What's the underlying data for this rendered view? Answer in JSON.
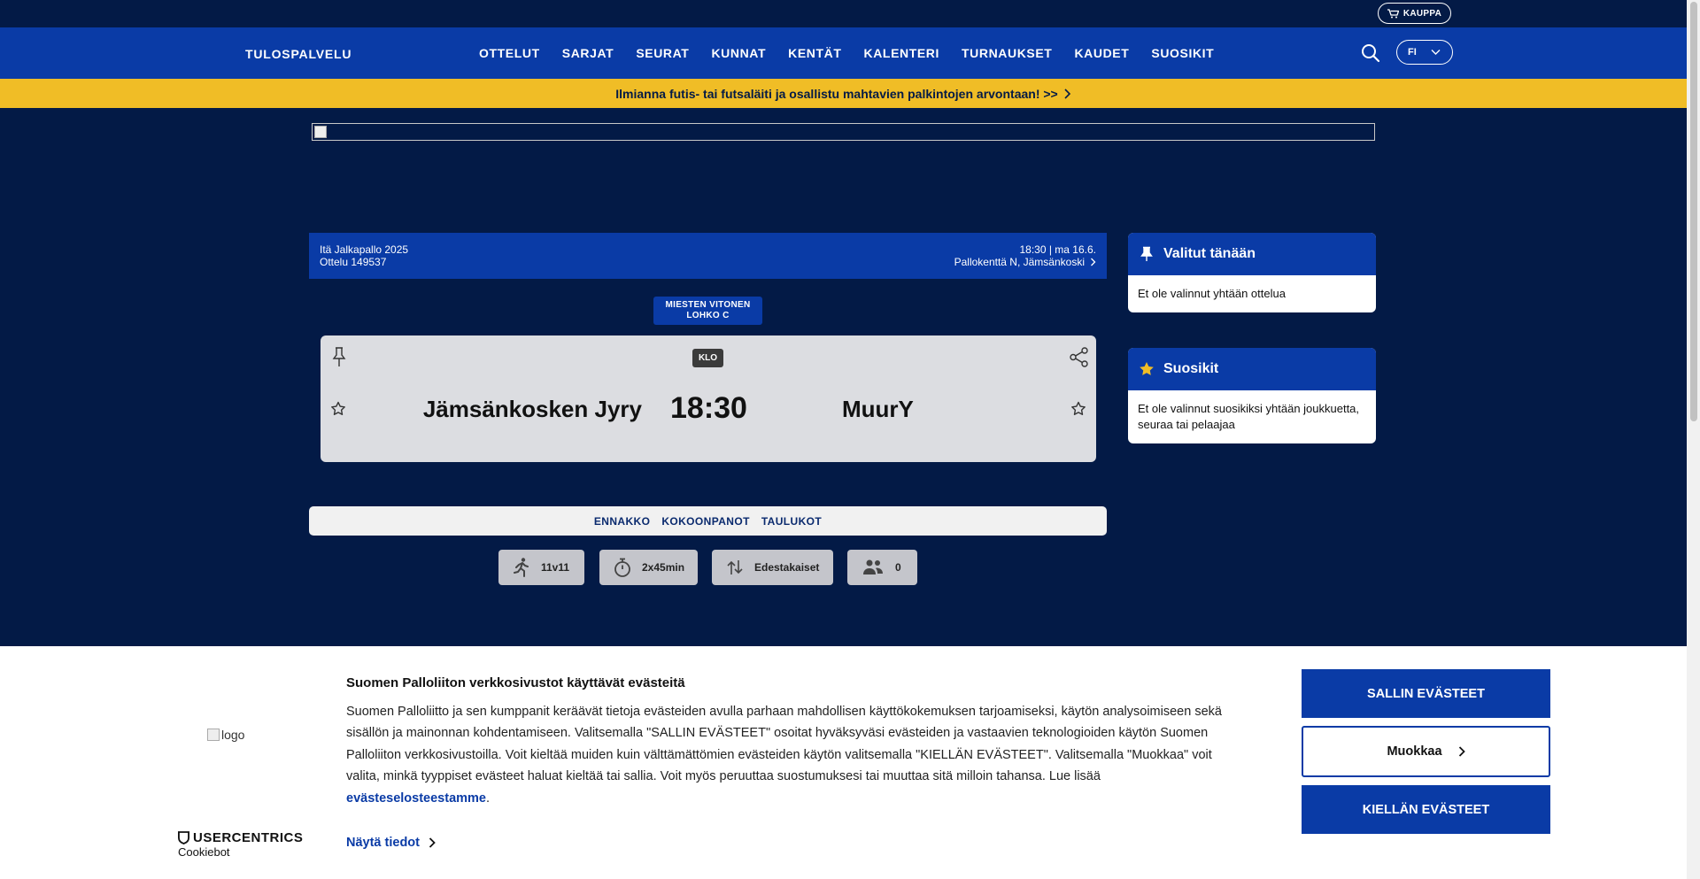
{
  "topbar": {
    "shop_label": "KAUPPA"
  },
  "nav": {
    "brand": "TULOSPALVELU",
    "items": [
      "OTTELUT",
      "SARJAT",
      "SEURAT",
      "KUNNAT",
      "KENTÄT",
      "KALENTERI",
      "TURNAUKSET",
      "KAUDET",
      "SUOSIKIT"
    ],
    "language": "FI"
  },
  "promo": {
    "text": "Ilmianna futis- tai futsaläiti ja osallistu mahtavien palkintojen arvontaan! >>"
  },
  "match": {
    "competition": "Itä Jalkapallo 2025",
    "match_id": "Ottelu 149537",
    "datetime": "18:30 | ma 16.6.",
    "venue": "Pallokenttä N, Jämsänkoski",
    "series_line1": "MIESTEN VITONEN",
    "series_line2": "LOHKO C",
    "status_badge": "KLO",
    "home_team": "Jämsänkosken Jyry",
    "time": "18:30",
    "away_team": "MuurY"
  },
  "tabs": [
    "ENNAKKO",
    "KOKOONPANOT",
    "TAULUKOT"
  ],
  "chips": [
    {
      "icon": "running-person-icon",
      "label": "11v11"
    },
    {
      "icon": "stopwatch-icon",
      "label": "2x45min"
    },
    {
      "icon": "swap-arrows-icon",
      "label": "Edestakaiset"
    },
    {
      "icon": "people-icon",
      "label": "0"
    }
  ],
  "sidebar": {
    "selected_title": "Valitut tänään",
    "selected_body": "Et ole valinnut yhtään ottelua",
    "favorites_title": "Suosikit",
    "favorites_body": "Et ole valinnut suosikiksi yhtään joukkuetta, seuraa tai pelaajaa"
  },
  "cookie": {
    "logo_alt": "logo",
    "brand": "USERCENTRICS",
    "brand_sub": "Cookiebot",
    "title": "Suomen Palloliiton verkkosivustot käyttävät evästeitä",
    "body": "Suomen Palloliitto ja sen kumppanit keräävät tietoja evästeiden avulla parhaan mahdollisen käyttökokemuksen tarjoamiseksi, käytön analysoimiseen sekä sisällön ja mainonnan kohdentamiseen. Valitsemalla \"SALLIN EVÄSTEET\" osoitat hyväksyväsi evästeiden ja vastaavien teknologioiden käytön Suomen Palloliiton verkkosivustoilla. Voit kieltää muiden kuin välttämättömien evästeiden käytön valitsemalla \"KIELLÄN EVÄSTEET\". Valitsemalla \"Muokkaa\" voit valita, minkä tyyppiset evästeet haluat kieltää tai sallia. Voit myös peruuttaa suostumuksesi tai muuttaa sitä milloin tahansa. Lue lisää ",
    "policy_link": "evästeselosteestamme",
    "body_end": ".",
    "details_label": "Näytä tiedot",
    "accept_label": "SALLIN EVÄSTEET",
    "edit_label": "Muokkaa",
    "deny_label": "KIELLÄN EVÄSTEET"
  },
  "colors": {
    "navy": "#031a46",
    "blue": "#0a3ba6",
    "yellow": "#f0bd26"
  }
}
